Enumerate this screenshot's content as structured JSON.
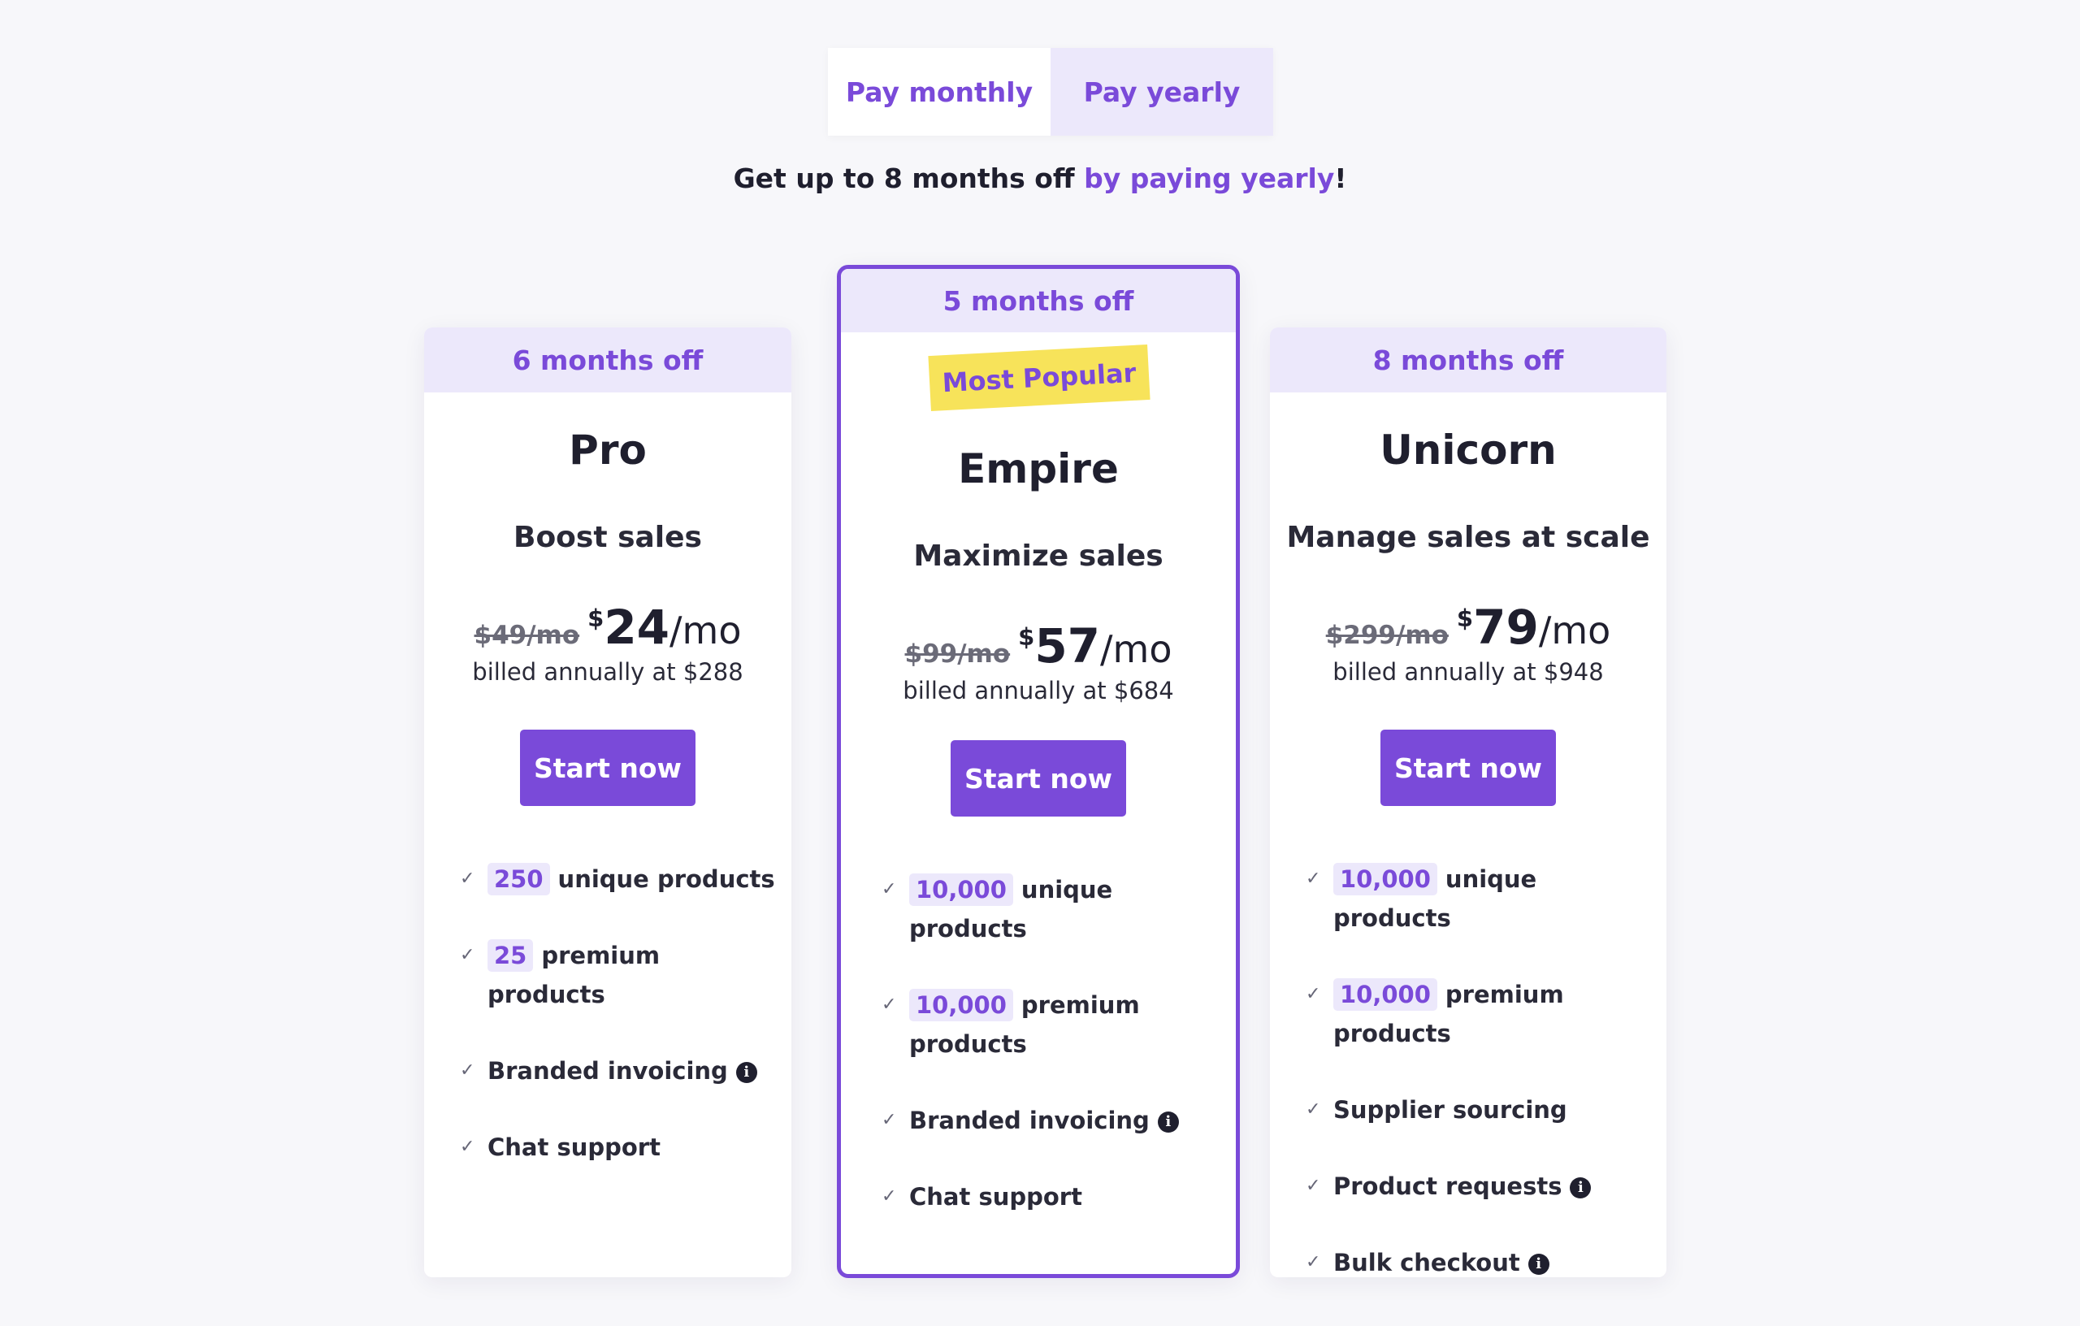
{
  "toggle": {
    "monthly_label": "Pay monthly",
    "yearly_label": "Pay yearly"
  },
  "promo": {
    "text_before": "Get up to 8 months off ",
    "highlight": "by paying yearly",
    "text_after": "!"
  },
  "plans": [
    {
      "banner": "6 months off",
      "name": "Pro",
      "tagline": "Boost sales",
      "old_price": "$49/mo",
      "currency": "$",
      "price": "24",
      "period": "/mo",
      "billed": "billed annually at $288",
      "cta": "Start now",
      "features": [
        {
          "num": "250",
          "text": "unique products"
        },
        {
          "num": "25",
          "text": "premium products"
        },
        {
          "text": "Branded invoicing",
          "info": "i"
        },
        {
          "text": "Chat support"
        }
      ]
    },
    {
      "banner": "5 months off",
      "badge": "Most Popular",
      "name": "Empire",
      "tagline": "Maximize sales",
      "old_price": "$99/mo",
      "currency": "$",
      "price": "57",
      "period": "/mo",
      "billed": "billed annually at $684",
      "cta": "Start now",
      "features": [
        {
          "num": "10,000",
          "text": "unique products"
        },
        {
          "num": "10,000",
          "text": "premium products"
        },
        {
          "text": "Branded invoicing",
          "info": "i"
        },
        {
          "text": "Chat support"
        }
      ]
    },
    {
      "banner": "8 months off",
      "name": "Unicorn",
      "tagline": "Manage sales at scale",
      "old_price": "$299/mo",
      "currency": "$",
      "price": "79",
      "period": "/mo",
      "billed": "billed annually at $948",
      "cta": "Start now",
      "features": [
        {
          "num": "10,000",
          "text": "unique products"
        },
        {
          "num": "10,000",
          "text": "premium products"
        },
        {
          "text": "Supplier sourcing"
        },
        {
          "text": "Product requests",
          "info": "i"
        },
        {
          "text": "Bulk checkout",
          "info": "i"
        }
      ]
    }
  ],
  "icons": {
    "check": "check-icon",
    "info": "info-icon"
  },
  "colors": {
    "accent": "#7a4ad9",
    "accent_light": "#ece8fb",
    "badge": "#f7e35a",
    "background": "#f7f7fa"
  }
}
